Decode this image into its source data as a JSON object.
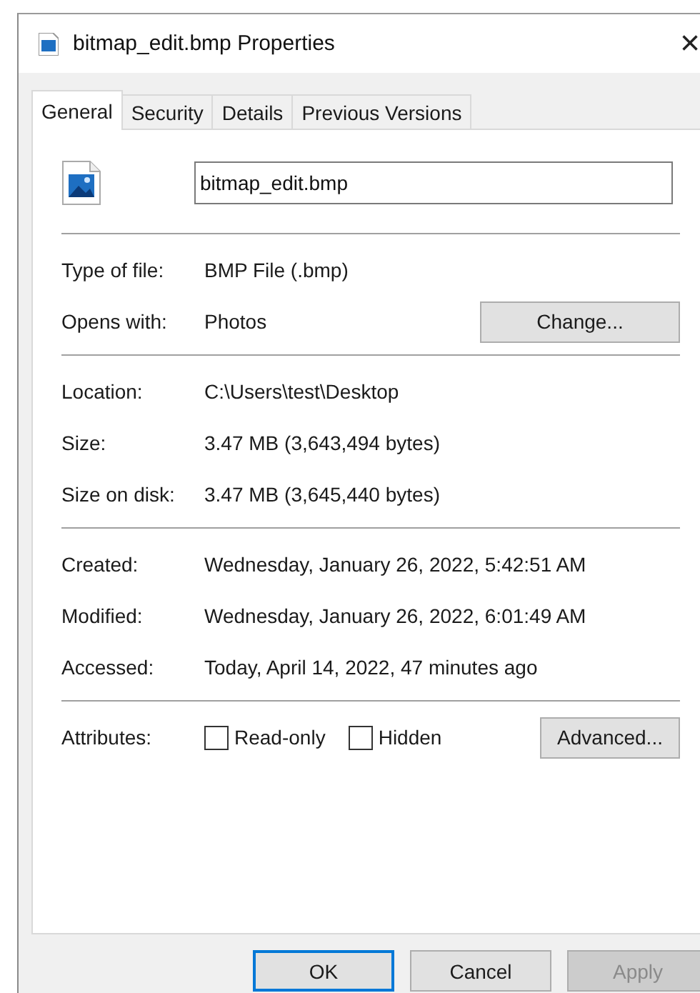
{
  "window": {
    "title": "bitmap_edit.bmp Properties",
    "close": "×"
  },
  "tabs": [
    {
      "label": "General",
      "selected": true
    },
    {
      "label": "Security",
      "selected": false
    },
    {
      "label": "Details",
      "selected": false
    },
    {
      "label": "Previous Versions",
      "selected": false
    }
  ],
  "file_name": "bitmap_edit.bmp",
  "sections": [
    [
      {
        "label": "Type of file:",
        "value": "BMP File (.bmp)"
      },
      {
        "label": "Opens with:",
        "value": "Photos",
        "button": "Change..."
      }
    ],
    [
      {
        "label": "Location:",
        "value": "C:\\Users\\test\\Desktop"
      },
      {
        "label": "Size:",
        "value": "3.47 MB (3,643,494 bytes)"
      },
      {
        "label": "Size on disk:",
        "value": "3.47 MB (3,645,440 bytes)"
      }
    ],
    [
      {
        "label": "Created:",
        "value": "Wednesday, January 26, 2022, 5:42:51 AM"
      },
      {
        "label": "Modified:",
        "value": "Wednesday, January 26, 2022, 6:01:49 AM"
      },
      {
        "label": "Accessed:",
        "value": "Today, April 14, 2022, 47 minutes ago"
      }
    ]
  ],
  "attributes": {
    "label": "Attributes:",
    "checkboxes": [
      {
        "label": "Read-only",
        "checked": false
      },
      {
        "label": "Hidden",
        "checked": false
      }
    ],
    "button": "Advanced..."
  },
  "buttons": [
    {
      "label": "OK",
      "default": true,
      "disabled": false
    },
    {
      "label": "Cancel",
      "default": false,
      "disabled": false
    },
    {
      "label": "Apply",
      "default": false,
      "disabled": true
    }
  ]
}
